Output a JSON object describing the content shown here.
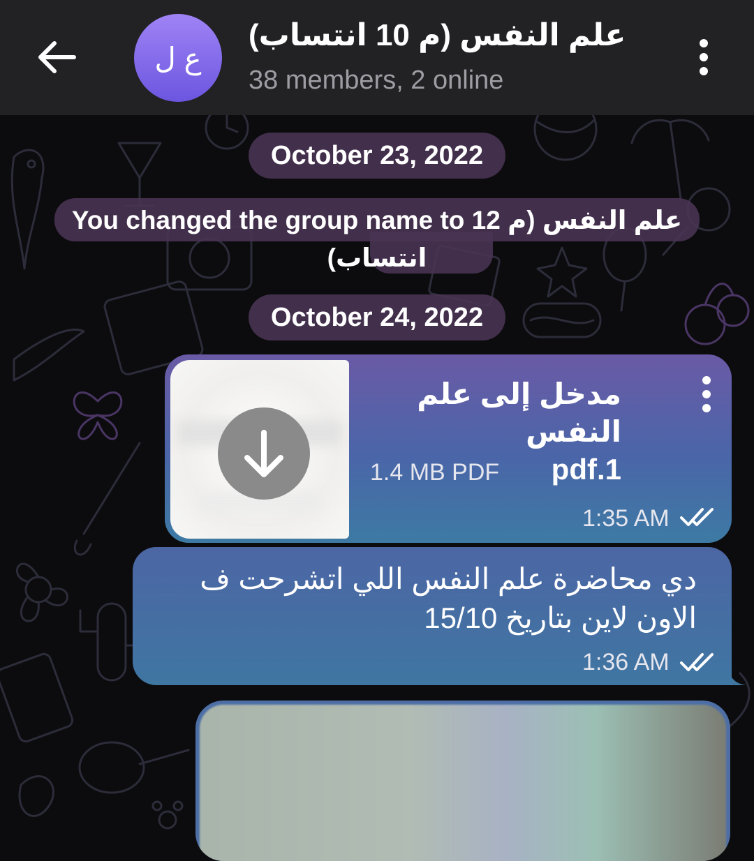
{
  "header": {
    "back_icon": "arrow-left-icon",
    "avatar_initials": "ع ل",
    "title": "علم النفس (م 10 انتساب)",
    "subtitle": "38 members, 2 online",
    "menu_icon": "more-vert-icon"
  },
  "messages": {
    "date_1": "October 23, 2022",
    "service_text": "You changed the group name to 12 علم النفس (م انتساب)",
    "date_2": "October 24, 2022",
    "file": {
      "name_line1": "مدخل إلى علم النفس",
      "name_line2": "pdf.1",
      "size": "1.4 MB PDF",
      "time": "1:35 AM",
      "status_icon": "double-check-icon",
      "download_icon": "download-arrow-icon"
    },
    "text_msg": {
      "text": "دي محاضرة علم النفس اللي اتشرحت ف الاون لاين بتاريخ 15/10",
      "time": "1:36 AM",
      "status_icon": "double-check-icon"
    }
  },
  "colors": {
    "header_bg": "#222225",
    "avatar_gradient_top": "#9f83f5",
    "avatar_gradient_bottom": "#6c56e0",
    "bubble_top": "#6a5aa6",
    "bubble_bottom": "#3d7aa4",
    "date_chip_bg": "#4a3454"
  }
}
